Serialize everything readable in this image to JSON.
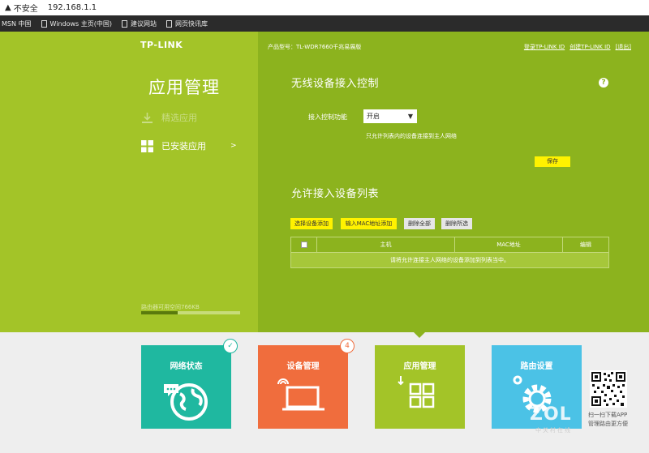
{
  "browser": {
    "security_label": "不安全",
    "url": "192.168.1.1",
    "bookmarks": [
      "MSN 中国",
      "Windows 主页(中国)",
      "建议网站",
      "网页快讯库"
    ]
  },
  "header": {
    "brand": "TP-LINK",
    "model": "产品型号：TL-WDR7660千兆易展版",
    "links": [
      "登录TP-LINK ID",
      "创建TP-LINK ID",
      "[退出]"
    ]
  },
  "sidebar": {
    "title": "应用管理",
    "items": [
      {
        "label": "精选应用",
        "icon": "download-icon"
      },
      {
        "label": "已安装应用",
        "icon": "grid-icon",
        "arrow": ">"
      }
    ],
    "storage_text": "路由器可用空间766KB",
    "storage_used_fraction": 0.37
  },
  "main": {
    "section1_title": "无线设备接入控制",
    "help": "?",
    "control_label": "接入控制功能",
    "control_value": "开启",
    "control_hint": "只允许列表内的设备连接到主人网络",
    "save_label": "保存",
    "section2_title": "允许接入设备列表",
    "actions": [
      "选择设备添加",
      "输入MAC地址添加",
      "删除全部",
      "删除所选"
    ],
    "table_headers": [
      "主机",
      "MAC地址",
      "编辑"
    ],
    "table_empty": "请将允许连接主人网络的设备添加到列表当中。"
  },
  "tiles": [
    {
      "label": "网络状态",
      "badge": "✓",
      "color": "#1fb8a0"
    },
    {
      "label": "设备管理",
      "badge": "4",
      "color": "#f06d3d"
    },
    {
      "label": "应用管理",
      "color": "#a3c428"
    },
    {
      "label": "路由设置",
      "color": "#4bc2e6"
    }
  ],
  "qr": {
    "line1": "扫一扫下载APP",
    "line2": "管理路由更方便"
  },
  "watermark": {
    "brand": "ZOL",
    "sub": "中关村在线"
  }
}
